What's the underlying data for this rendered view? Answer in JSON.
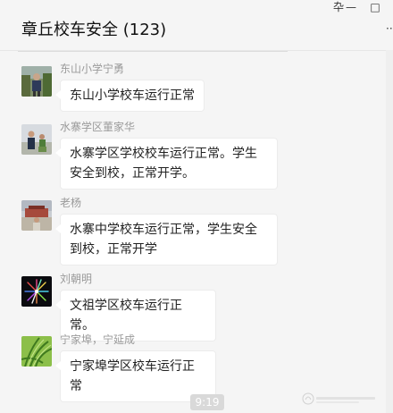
{
  "window": {
    "title": "章丘校车安全 (123)",
    "pin_icon": "pin-icon",
    "pin_glyph": "卆",
    "minimize_glyph": "—",
    "maximize_glyph": "□"
  },
  "messages": [
    {
      "sender": "东山小学宁勇",
      "text": "东山小学校车运行正常",
      "avatar_icon": "person-photo-avatar"
    },
    {
      "sender": "水寨学区董家华",
      "text": "水寨学区学校校车运行正常。学生安全到校，正常开学。",
      "avatar_icon": "person-photo-avatar"
    },
    {
      "sender": "老杨",
      "text": "水寨中学校车运行正常，学生安全到校，正常开学",
      "avatar_icon": "landmark-photo-avatar"
    },
    {
      "sender": "刘朝明",
      "text": "文祖学区校车运行正常。",
      "avatar_icon": "firework-avatar"
    },
    {
      "sender": "宁家埠，宁延成",
      "text": "宁家埠学区校车运行正常",
      "avatar_icon": "plant-avatar"
    }
  ],
  "time_badge": "9:19",
  "colors": {
    "background": "#f5f5f5",
    "bubble": "#ffffff",
    "sender_text": "#9a9a9a",
    "time_badge": "#d9d9d9"
  }
}
